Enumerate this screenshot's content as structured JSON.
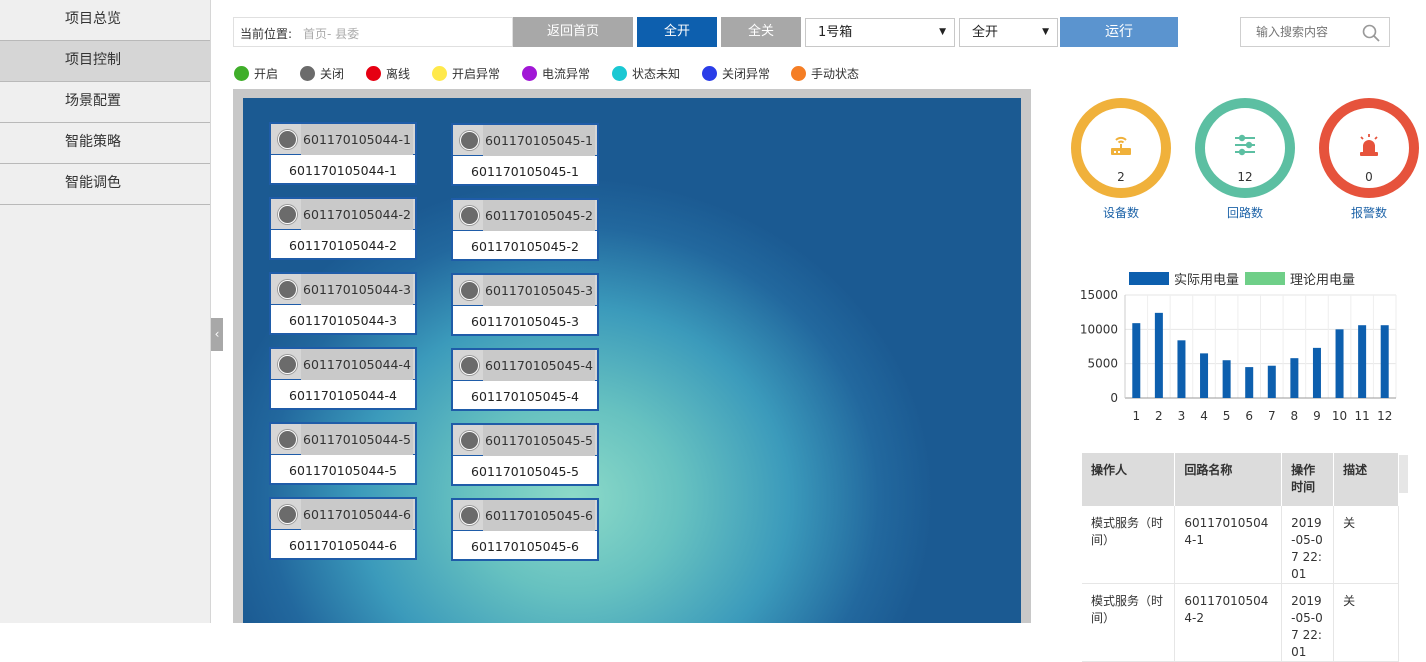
{
  "sidebar": {
    "items": [
      {
        "label": "项目总览"
      },
      {
        "label": "项目控制"
      },
      {
        "label": "场景配置"
      },
      {
        "label": "智能策略"
      },
      {
        "label": "智能调色"
      }
    ],
    "collapse": "‹"
  },
  "toolbar": {
    "location_label": "当前位置:",
    "location_value": "首页- 县委",
    "home_button": "返回首页",
    "all_on_button": "全开",
    "all_off_button": "全关",
    "box_select": "1号箱",
    "mode_select": "全开",
    "run_button": "运行",
    "search_placeholder": "输入搜索内容"
  },
  "legend": [
    {
      "label": "开启",
      "color": "#3fae2a"
    },
    {
      "label": "关闭",
      "color": "#6b6b6b"
    },
    {
      "label": "离线",
      "color": "#e60012"
    },
    {
      "label": "开启异常",
      "color": "#ffe94b"
    },
    {
      "label": "电流异常",
      "color": "#a117d6"
    },
    {
      "label": "状态未知",
      "color": "#1ac8d3"
    },
    {
      "label": "关闭异常",
      "color": "#2a3de8"
    },
    {
      "label": "手动状态",
      "color": "#f57e25"
    }
  ],
  "switches": {
    "col1": [
      {
        "title": "601170105044-1",
        "name": "601170105044-1"
      },
      {
        "title": "601170105044-2",
        "name": "601170105044-2"
      },
      {
        "title": "601170105044-3",
        "name": "601170105044-3"
      },
      {
        "title": "601170105044-4",
        "name": "601170105044-4"
      },
      {
        "title": "601170105044-5",
        "name": "601170105044-5"
      },
      {
        "title": "601170105044-6",
        "name": "601170105044-6"
      }
    ],
    "col2": [
      {
        "title": "601170105045-1",
        "name": "601170105045-1"
      },
      {
        "title": "601170105045-2",
        "name": "601170105045-2"
      },
      {
        "title": "601170105045-3",
        "name": "601170105045-3"
      },
      {
        "title": "601170105045-4",
        "name": "601170105045-4"
      },
      {
        "title": "601170105045-5",
        "name": "601170105045-5"
      },
      {
        "title": "601170105045-6",
        "name": "601170105045-6"
      }
    ],
    "status_color": "#6b6b6b"
  },
  "stats": {
    "devices": {
      "value": "2",
      "label": "设备数",
      "color": "#f0b13b",
      "icon": "router-icon"
    },
    "circuits": {
      "value": "12",
      "label": "回路数",
      "color": "#5cbfa2",
      "icon": "sliders-icon"
    },
    "alarms": {
      "value": "0",
      "label": "报警数",
      "color": "#e6533c",
      "icon": "alarm-icon"
    }
  },
  "chart_data": {
    "type": "bar",
    "categories": [
      "1",
      "2",
      "3",
      "4",
      "5",
      "6",
      "7",
      "8",
      "9",
      "10",
      "11",
      "12"
    ],
    "series": [
      {
        "name": "实际用电量",
        "color": "#0d5fae",
        "values": [
          10900,
          12400,
          8400,
          6500,
          5500,
          4500,
          4700,
          5800,
          7300,
          10000,
          10600,
          10600
        ]
      },
      {
        "name": "理论用电量",
        "color": "#6fcf88",
        "values": []
      }
    ],
    "yticks": [
      "0",
      "5000",
      "10000",
      "15000"
    ],
    "ylim": [
      0,
      15000
    ]
  },
  "table": {
    "headers": [
      "操作人",
      "回路名称",
      "操作时间",
      "描述"
    ],
    "rows": [
      [
        "模式服务（时间）",
        "601170105044-1",
        "2019-05-07 22:01",
        "关"
      ],
      [
        "模式服务（时间）",
        "601170105044-2",
        "2019-05-07 22:01",
        "关"
      ]
    ]
  }
}
